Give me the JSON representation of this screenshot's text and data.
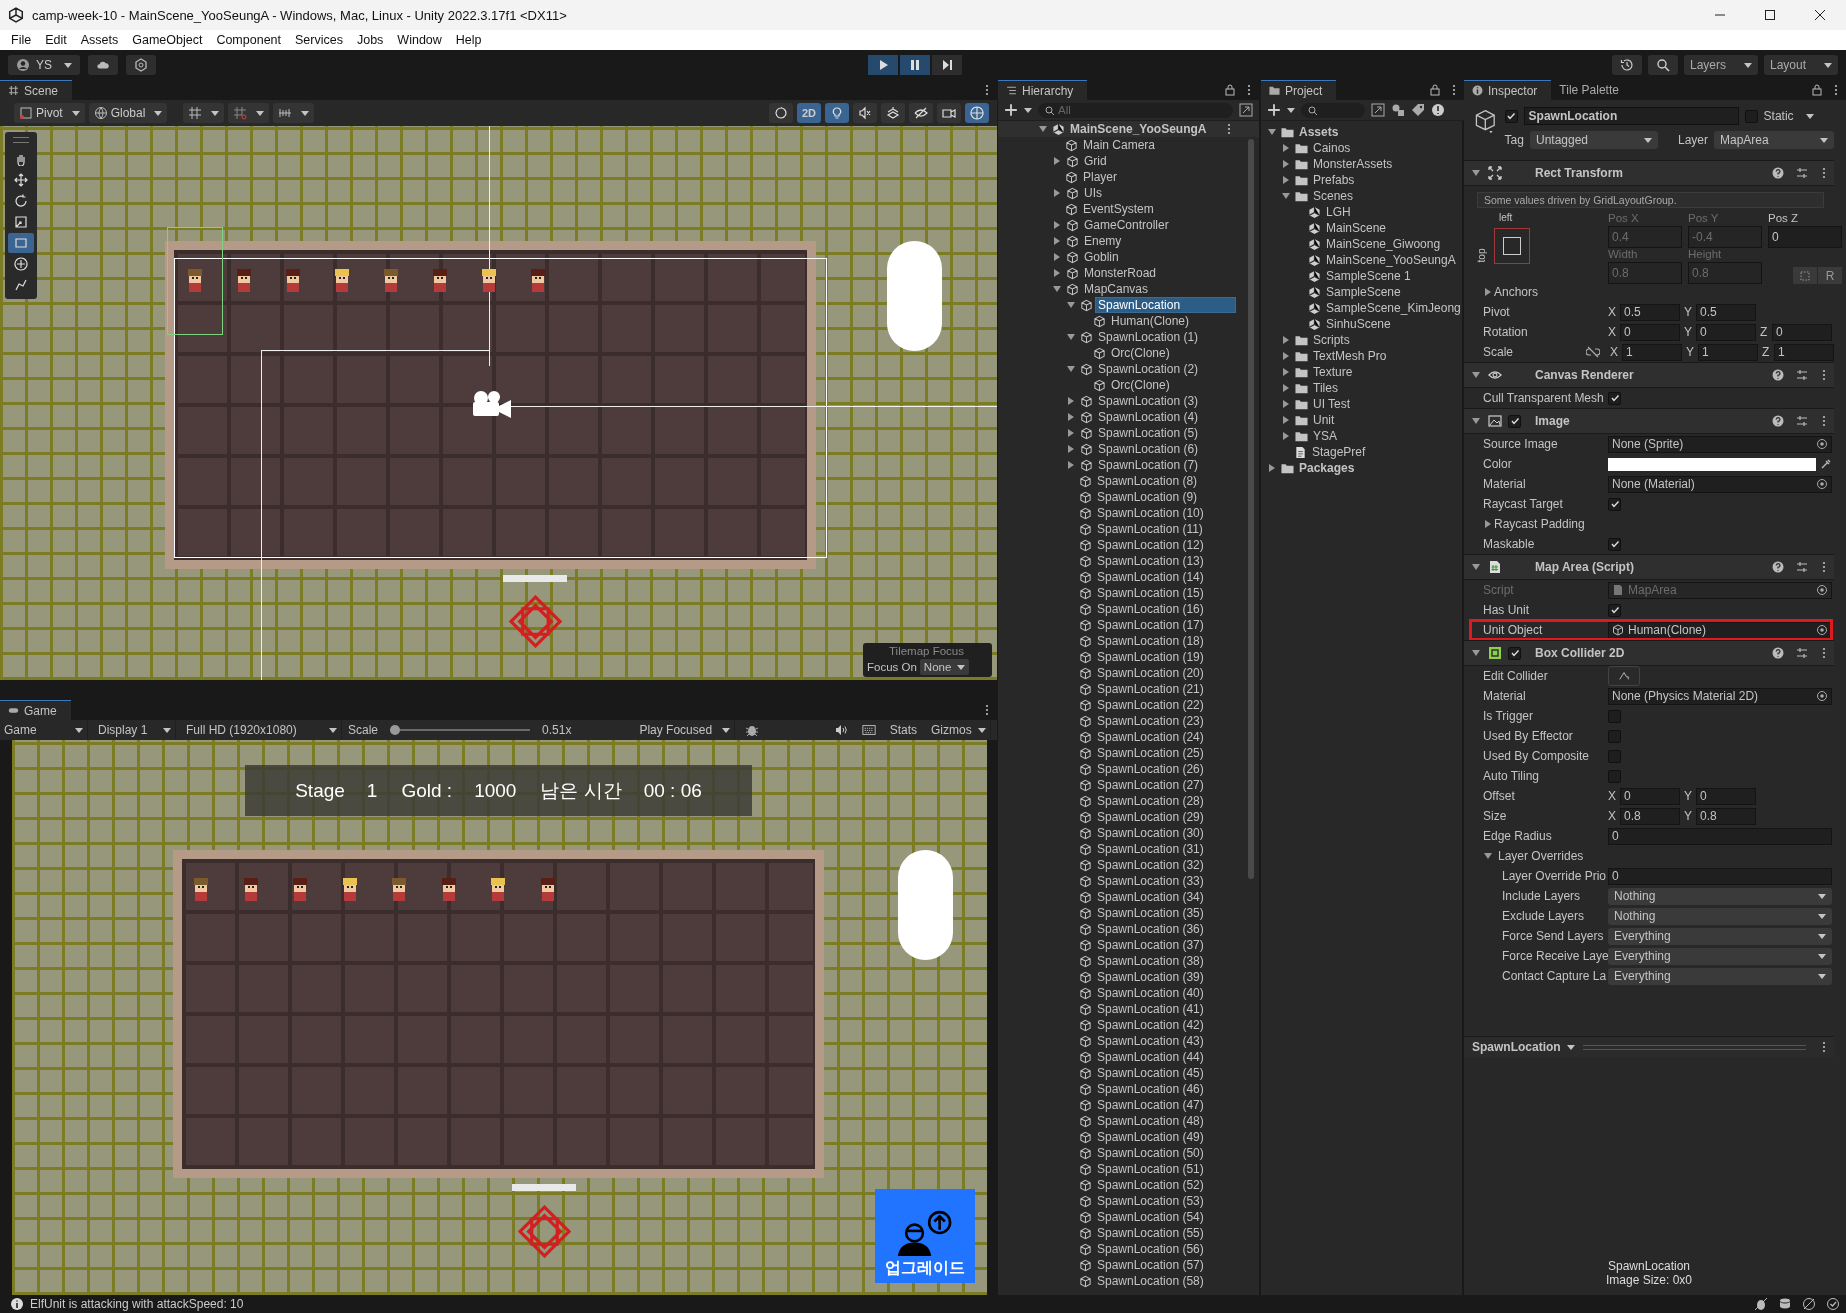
{
  "window": {
    "title": "camp-week-10 - MainScene_YooSeungA - Windows, Mac, Linux - Unity 2022.3.17f1 <DX11>"
  },
  "menu": [
    "File",
    "Edit",
    "Assets",
    "GameObject",
    "Component",
    "Services",
    "Jobs",
    "Window",
    "Help"
  ],
  "toolbar": {
    "account": "YS",
    "play_controls": [
      {
        "kind": "play",
        "on": true
      },
      {
        "kind": "pause",
        "on": true
      },
      {
        "kind": "step",
        "on": false
      }
    ],
    "layers": "Layers",
    "layout": "Layout"
  },
  "scene": {
    "tab": "Scene",
    "pivot": "Pivot",
    "global": "Global",
    "view_toggles": [
      {
        "kind": "shading",
        "on": false
      },
      {
        "kind": "dimension",
        "label": "2D",
        "on": true
      },
      {
        "kind": "lighting",
        "on": true
      },
      {
        "kind": "audio",
        "on": false
      },
      {
        "kind": "effects",
        "on": false
      },
      {
        "kind": "visibility",
        "on": false
      },
      {
        "kind": "camera",
        "on": false
      },
      {
        "kind": "gizmos",
        "on": true
      }
    ],
    "tools": [
      {
        "kind": "hand",
        "selected": false
      },
      {
        "kind": "move",
        "selected": false
      },
      {
        "kind": "rotate",
        "selected": false
      },
      {
        "kind": "scale",
        "selected": false
      },
      {
        "kind": "rect",
        "selected": true
      },
      {
        "kind": "transform",
        "selected": false
      },
      {
        "kind": "custom",
        "selected": false
      }
    ],
    "units": [
      {
        "kind": "helmet"
      },
      {
        "kind": "red"
      },
      {
        "kind": "red"
      },
      {
        "kind": "blond"
      },
      {
        "kind": "helmet"
      },
      {
        "kind": "red"
      },
      {
        "kind": "blond"
      },
      {
        "kind": "red"
      }
    ],
    "tilemap_focus": {
      "title": "Tilemap Focus",
      "label": "Focus On",
      "value": "None"
    }
  },
  "game": {
    "tab": "Game",
    "view": "Game",
    "display": "Display 1",
    "resolution": "Full HD (1920x1080)",
    "scale_label": "Scale",
    "scale": {
      "level": 0
    },
    "scale_value": "0.51x",
    "play_mode": "Play Focused",
    "stats": "Stats",
    "gizmos": "Gizmos",
    "hud": [
      "Stage",
      "1",
      "Gold :",
      "1000",
      "남은 시간",
      "00 : 06"
    ],
    "units": [
      {
        "kind": "helmet"
      },
      {
        "kind": "red"
      },
      {
        "kind": "red"
      },
      {
        "kind": "blond"
      },
      {
        "kind": "helmet"
      },
      {
        "kind": "red"
      },
      {
        "kind": "blond"
      },
      {
        "kind": "red"
      }
    ],
    "upgrade": "업그레이드"
  },
  "hierarchy": {
    "tab": "Hierarchy",
    "search": {
      "placeholder": "All"
    },
    "scene": {
      "name": "MainScene_YooSeungA",
      "children": [
        {
          "name": "Main Camera",
          "selected": false
        },
        {
          "name": "Grid",
          "expanded": false,
          "selected": false
        },
        {
          "name": "Player",
          "selected": false
        },
        {
          "name": "UIs",
          "expanded": false,
          "selected": false
        },
        {
          "name": "EventSystem",
          "selected": false
        },
        {
          "name": "GameController",
          "expanded": false,
          "selected": false
        },
        {
          "name": "Enemy",
          "expanded": false,
          "selected": false
        },
        {
          "name": "Goblin",
          "expanded": false,
          "selected": false
        },
        {
          "name": "MonsterRoad",
          "expanded": false,
          "selected": false
        },
        {
          "name": "MapCanvas",
          "expanded": true,
          "selected": false,
          "children": [
            {
              "name": "SpawnLocation",
              "expanded": true,
              "selected": true,
              "children": [
                {
                  "name": "Human(Clone)",
                  "selected": false
                }
              ]
            },
            {
              "name": "SpawnLocation (1)",
              "expanded": true,
              "selected": false,
              "children": [
                {
                  "name": "Orc(Clone)",
                  "selected": false
                }
              ]
            },
            {
              "name": "SpawnLocation (2)",
              "expanded": true,
              "selected": false,
              "children": [
                {
                  "name": "Orc(Clone)",
                  "selected": false
                }
              ]
            },
            {
              "name": "SpawnLocation (3)",
              "expanded": false,
              "selected": false
            },
            {
              "name": "SpawnLocation (4)",
              "expanded": false,
              "selected": false
            },
            {
              "name": "SpawnLocation (5)",
              "expanded": false,
              "selected": false
            },
            {
              "name": "SpawnLocation (6)",
              "expanded": false,
              "selected": false
            },
            {
              "name": "SpawnLocation (7)",
              "expanded": false,
              "selected": false
            },
            {
              "name": "SpawnLocation (8)",
              "selected": false
            },
            {
              "name": "SpawnLocation (9)",
              "selected": false
            },
            {
              "name": "SpawnLocation (10)",
              "selected": false
            },
            {
              "name": "SpawnLocation (11)",
              "selected": false
            },
            {
              "name": "SpawnLocation (12)",
              "selected": false
            },
            {
              "name": "SpawnLocation (13)",
              "selected": false
            },
            {
              "name": "SpawnLocation (14)",
              "selected": false
            },
            {
              "name": "SpawnLocation (15)",
              "selected": false
            },
            {
              "name": "SpawnLocation (16)",
              "selected": false
            },
            {
              "name": "SpawnLocation (17)",
              "selected": false
            },
            {
              "name": "SpawnLocation (18)",
              "selected": false
            },
            {
              "name": "SpawnLocation (19)",
              "selected": false
            },
            {
              "name": "SpawnLocation (20)",
              "selected": false
            },
            {
              "name": "SpawnLocation (21)",
              "selected": false
            },
            {
              "name": "SpawnLocation (22)",
              "selected": false
            },
            {
              "name": "SpawnLocation (23)",
              "selected": false
            },
            {
              "name": "SpawnLocation (24)",
              "selected": false
            },
            {
              "name": "SpawnLocation (25)",
              "selected": false
            },
            {
              "name": "SpawnLocation (26)",
              "selected": false
            },
            {
              "name": "SpawnLocation (27)",
              "selected": false
            },
            {
              "name": "SpawnLocation (28)",
              "selected": false
            },
            {
              "name": "SpawnLocation (29)",
              "selected": false
            },
            {
              "name": "SpawnLocation (30)",
              "selected": false
            },
            {
              "name": "SpawnLocation (31)",
              "selected": false
            },
            {
              "name": "SpawnLocation (32)",
              "selected": false
            },
            {
              "name": "SpawnLocation (33)",
              "selected": false
            },
            {
              "name": "SpawnLocation (34)",
              "selected": false
            },
            {
              "name": "SpawnLocation (35)",
              "selected": false
            },
            {
              "name": "SpawnLocation (36)",
              "selected": false
            },
            {
              "name": "SpawnLocation (37)",
              "selected": false
            },
            {
              "name": "SpawnLocation (38)",
              "selected": false
            },
            {
              "name": "SpawnLocation (39)",
              "selected": false
            },
            {
              "name": "SpawnLocation (40)",
              "selected": false
            },
            {
              "name": "SpawnLocation (41)",
              "selected": false
            },
            {
              "name": "SpawnLocation (42)",
              "selected": false
            },
            {
              "name": "SpawnLocation (43)",
              "selected": false
            },
            {
              "name": "SpawnLocation (44)",
              "selected": false
            },
            {
              "name": "SpawnLocation (45)",
              "selected": false
            },
            {
              "name": "SpawnLocation (46)",
              "selected": false
            },
            {
              "name": "SpawnLocation (47)",
              "selected": false
            },
            {
              "name": "SpawnLocation (48)",
              "selected": false
            },
            {
              "name": "SpawnLocation (49)",
              "selected": false
            },
            {
              "name": "SpawnLocation (50)",
              "selected": false
            },
            {
              "name": "SpawnLocation (51)",
              "selected": false
            },
            {
              "name": "SpawnLocation (52)",
              "selected": false
            },
            {
              "name": "SpawnLocation (53)",
              "selected": false
            },
            {
              "name": "SpawnLocation (54)",
              "selected": false
            },
            {
              "name": "SpawnLocation (55)",
              "selected": false
            },
            {
              "name": "SpawnLocation (56)",
              "selected": false
            },
            {
              "name": "SpawnLocation (57)",
              "selected": false
            },
            {
              "name": "SpawnLocation (58)",
              "selected": false
            }
          ]
        }
      ]
    }
  },
  "project": {
    "tab": "Project",
    "tree": [
      {
        "name": "Assets",
        "kind": "folder",
        "expanded": true,
        "children": [
          {
            "name": "Cainos",
            "kind": "folder",
            "expanded": false
          },
          {
            "name": "MonsterAssets",
            "kind": "folder",
            "expanded": false
          },
          {
            "name": "Prefabs",
            "kind": "folder",
            "expanded": false
          },
          {
            "name": "Scenes",
            "kind": "folder",
            "expanded": true,
            "children": [
              {
                "name": "LGH",
                "kind": "scene"
              },
              {
                "name": "MainScene",
                "kind": "scene"
              },
              {
                "name": "MainScene_Giwoong",
                "kind": "scene"
              },
              {
                "name": "MainScene_YooSeungA",
                "kind": "scene"
              },
              {
                "name": "SampleScene 1",
                "kind": "scene"
              },
              {
                "name": "SampleScene",
                "kind": "scene"
              },
              {
                "name": "SampleScene_KimJeong",
                "kind": "scene"
              },
              {
                "name": "SinhuScene",
                "kind": "scene"
              }
            ]
          },
          {
            "name": "Scripts",
            "kind": "folder",
            "expanded": false
          },
          {
            "name": "TextMesh Pro",
            "kind": "folder",
            "expanded": false
          },
          {
            "name": "Texture",
            "kind": "folder",
            "expanded": false
          },
          {
            "name": "Tiles",
            "kind": "folder",
            "expanded": false
          },
          {
            "name": "UI Test",
            "kind": "folder",
            "expanded": false
          },
          {
            "name": "Unit",
            "kind": "folder",
            "expanded": false
          },
          {
            "name": "YSA",
            "kind": "folder",
            "expanded": false
          },
          {
            "name": "StagePref",
            "kind": "file"
          }
        ]
      },
      {
        "name": "Packages",
        "kind": "folder",
        "expanded": false
      }
    ]
  },
  "inspector": {
    "tabs": [
      {
        "label": "Inspector",
        "selected": true
      },
      {
        "label": "Tile Palette",
        "selected": false
      }
    ],
    "active": true,
    "name": "SpawnLocation",
    "static": {
      "label": "Static",
      "checked": false
    },
    "tag": {
      "label": "Tag",
      "value": "Untagged"
    },
    "layer": {
      "label": "Layer",
      "value": "MapArea"
    },
    "components": [
      {
        "title": "Rect Transform",
        "kind": "rect",
        "note": "Some values driven by GridLayoutGroup.",
        "anchor": {
          "h": "left",
          "v": "top"
        },
        "fields": [
          {
            "label": "Pos X",
            "value": "0.4",
            "disabled": true
          },
          {
            "label": "Pos Y",
            "value": "-0.4",
            "disabled": true
          },
          {
            "label": "Pos Z",
            "value": "0",
            "disabled": false
          },
          {
            "label": "Width",
            "value": "0.8",
            "disabled": true
          },
          {
            "label": "Height",
            "value": "0.8",
            "disabled": true
          }
        ],
        "r_button": "R",
        "rows": [
          {
            "kind": "foldout",
            "label": "Anchors",
            "expanded": false
          },
          {
            "kind": "vec",
            "label": "Pivot",
            "fields": [
              {
                "axis": "X",
                "value": "0.5"
              },
              {
                "axis": "Y",
                "value": "0.5"
              }
            ]
          },
          {
            "kind": "vec",
            "label": "Rotation",
            "fields": [
              {
                "axis": "X",
                "value": "0"
              },
              {
                "axis": "Y",
                "value": "0"
              },
              {
                "axis": "Z",
                "value": "0"
              }
            ]
          },
          {
            "kind": "scale",
            "label": "Scale",
            "fields": [
              {
                "axis": "X",
                "value": "1"
              },
              {
                "axis": "Y",
                "value": "1"
              },
              {
                "axis": "Z",
                "value": "1"
              }
            ]
          }
        ]
      },
      {
        "title": "Canvas Renderer",
        "kind": "renderer",
        "rows": [
          {
            "kind": "check",
            "label": "Cull Transparent Mesh",
            "checked": true
          }
        ]
      },
      {
        "title": "Image",
        "kind": "image",
        "enabled": true,
        "rows": [
          {
            "kind": "object",
            "label": "Source Image",
            "value": "None (Sprite)"
          },
          {
            "kind": "color",
            "label": "Color",
            "color": "#ffffff"
          },
          {
            "kind": "object",
            "label": "Material",
            "value": "None (Material)"
          },
          {
            "kind": "check",
            "label": "Raycast Target",
            "checked": true
          },
          {
            "kind": "foldout",
            "label": "Raycast Padding",
            "expanded": false
          },
          {
            "kind": "check",
            "label": "Maskable",
            "checked": true
          }
        ]
      },
      {
        "title": "Map Area (Script)",
        "kind": "script",
        "rows": [
          {
            "kind": "script-ref",
            "label": "Script",
            "value": "MapArea",
            "disabled": true,
            "highlighted": false
          },
          {
            "kind": "check",
            "label": "Has Unit",
            "checked": true,
            "disabled": false,
            "highlighted": false
          },
          {
            "kind": "object-ref",
            "label": "Unit Object",
            "value": "Human(Clone)",
            "disabled": false,
            "highlighted": true
          }
        ]
      },
      {
        "title": "Box Collider 2D",
        "kind": "collider",
        "enabled": true,
        "rows": [
          {
            "kind": "button",
            "label": "Edit Collider"
          },
          {
            "kind": "object",
            "label": "Material",
            "value": "None (Physics Material 2D)"
          },
          {
            "kind": "check",
            "label": "Is Trigger",
            "checked": false
          },
          {
            "kind": "check",
            "label": "Used By Effector",
            "checked": false
          },
          {
            "kind": "check",
            "label": "Used By Composite",
            "checked": false
          },
          {
            "kind": "check",
            "label": "Auto Tiling",
            "checked": false
          },
          {
            "kind": "vec",
            "label": "Offset",
            "fields": [
              {
                "axis": "X",
                "value": "0"
              },
              {
                "axis": "Y",
                "value": "0"
              }
            ]
          },
          {
            "kind": "vec",
            "label": "Size",
            "fields": [
              {
                "axis": "X",
                "value": "0.8"
              },
              {
                "axis": "Y",
                "value": "0.8"
              }
            ]
          },
          {
            "kind": "text",
            "label": "Edge Radius",
            "value": "0"
          },
          {
            "kind": "foldout",
            "label": "Layer Overrides",
            "expanded": true,
            "children": [
              {
                "kind": "text",
                "label": "Layer Override Prio",
                "value": "0"
              },
              {
                "kind": "dropdown",
                "label": "Include Layers",
                "value": "Nothing"
              },
              {
                "kind": "dropdown",
                "label": "Exclude Layers",
                "value": "Nothing"
              },
              {
                "kind": "dropdown",
                "label": "Force Send Layers",
                "value": "Everything"
              },
              {
                "kind": "dropdown",
                "label": "Force Receive Laye",
                "value": "Everything"
              },
              {
                "kind": "dropdown",
                "label": "Contact Capture La",
                "value": "Everything"
              }
            ]
          }
        ]
      }
    ],
    "preview": {
      "title": "SpawnLocation",
      "caption": "SpawnLocation",
      "info": "Image Size: 0x0"
    }
  },
  "status": {
    "message": "ElfUnit is attacking with attackSpeed: 10"
  }
}
